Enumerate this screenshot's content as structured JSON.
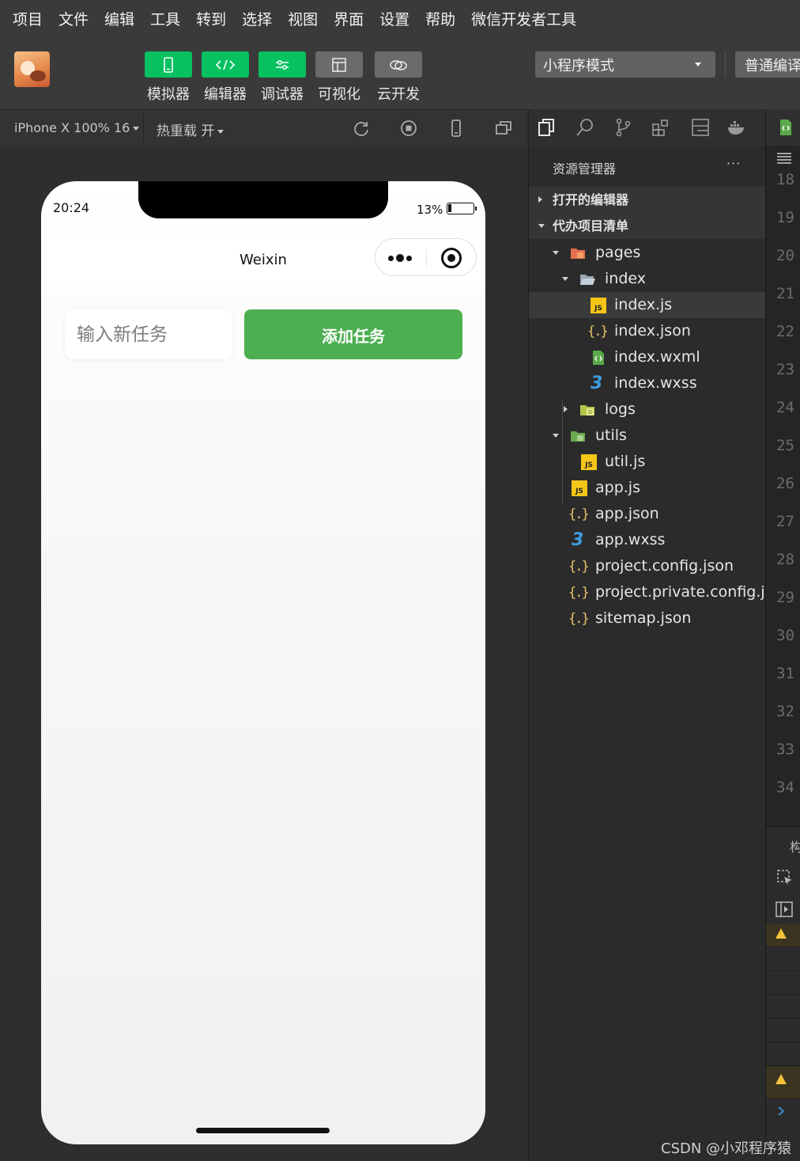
{
  "menu": [
    "项目",
    "文件",
    "编辑",
    "工具",
    "转到",
    "选择",
    "视图",
    "界面",
    "设置",
    "帮助",
    "微信开发者工具"
  ],
  "toolbar": {
    "buttons": [
      {
        "label": "模拟器",
        "icon": "phone-icon",
        "active": true
      },
      {
        "label": "编辑器",
        "icon": "code-icon",
        "active": true
      },
      {
        "label": "调试器",
        "icon": "sliders-icon",
        "active": true
      },
      {
        "label": "可视化",
        "icon": "layout-icon",
        "active": false
      },
      {
        "label": "云开发",
        "icon": "cloud-icon",
        "active": false
      }
    ],
    "mode": "小程序模式",
    "compile": "普通编译"
  },
  "simbar": {
    "device": "iPhone X 100% 16",
    "hot_reload": "热重载 开"
  },
  "phone": {
    "time": "20:24",
    "battery": "13%",
    "nav_title": "Weixin",
    "input_placeholder": "输入新任务",
    "add_button": "添加任务"
  },
  "explorer": {
    "title": "资源管理器",
    "more": "···",
    "open_editors": "打开的编辑器",
    "project": "代办项目清单",
    "files": {
      "pages": "pages",
      "index": "index",
      "index_js": "index.js",
      "index_json": "index.json",
      "index_wxml": "index.wxml",
      "index_wxss": "index.wxss",
      "logs": "logs",
      "utils": "utils",
      "util_js": "util.js",
      "app_js": "app.js",
      "app_json": "app.json",
      "app_wxss": "app.wxss",
      "project_config": "project.config.json",
      "project_private": "project.private.config.js...",
      "sitemap": "sitemap.json"
    }
  },
  "editor": {
    "line_numbers": [
      "18",
      "19",
      "20",
      "21",
      "22",
      "23",
      "24",
      "25",
      "26",
      "27",
      "28",
      "29",
      "30",
      "31",
      "32",
      "33",
      "34"
    ],
    "panel_tab": "构"
  },
  "watermark": "CSDN @小邓程序猿",
  "colors": {
    "accent_green": "#07c160",
    "add_button": "#4caf50",
    "warning": "#f3c23a"
  }
}
